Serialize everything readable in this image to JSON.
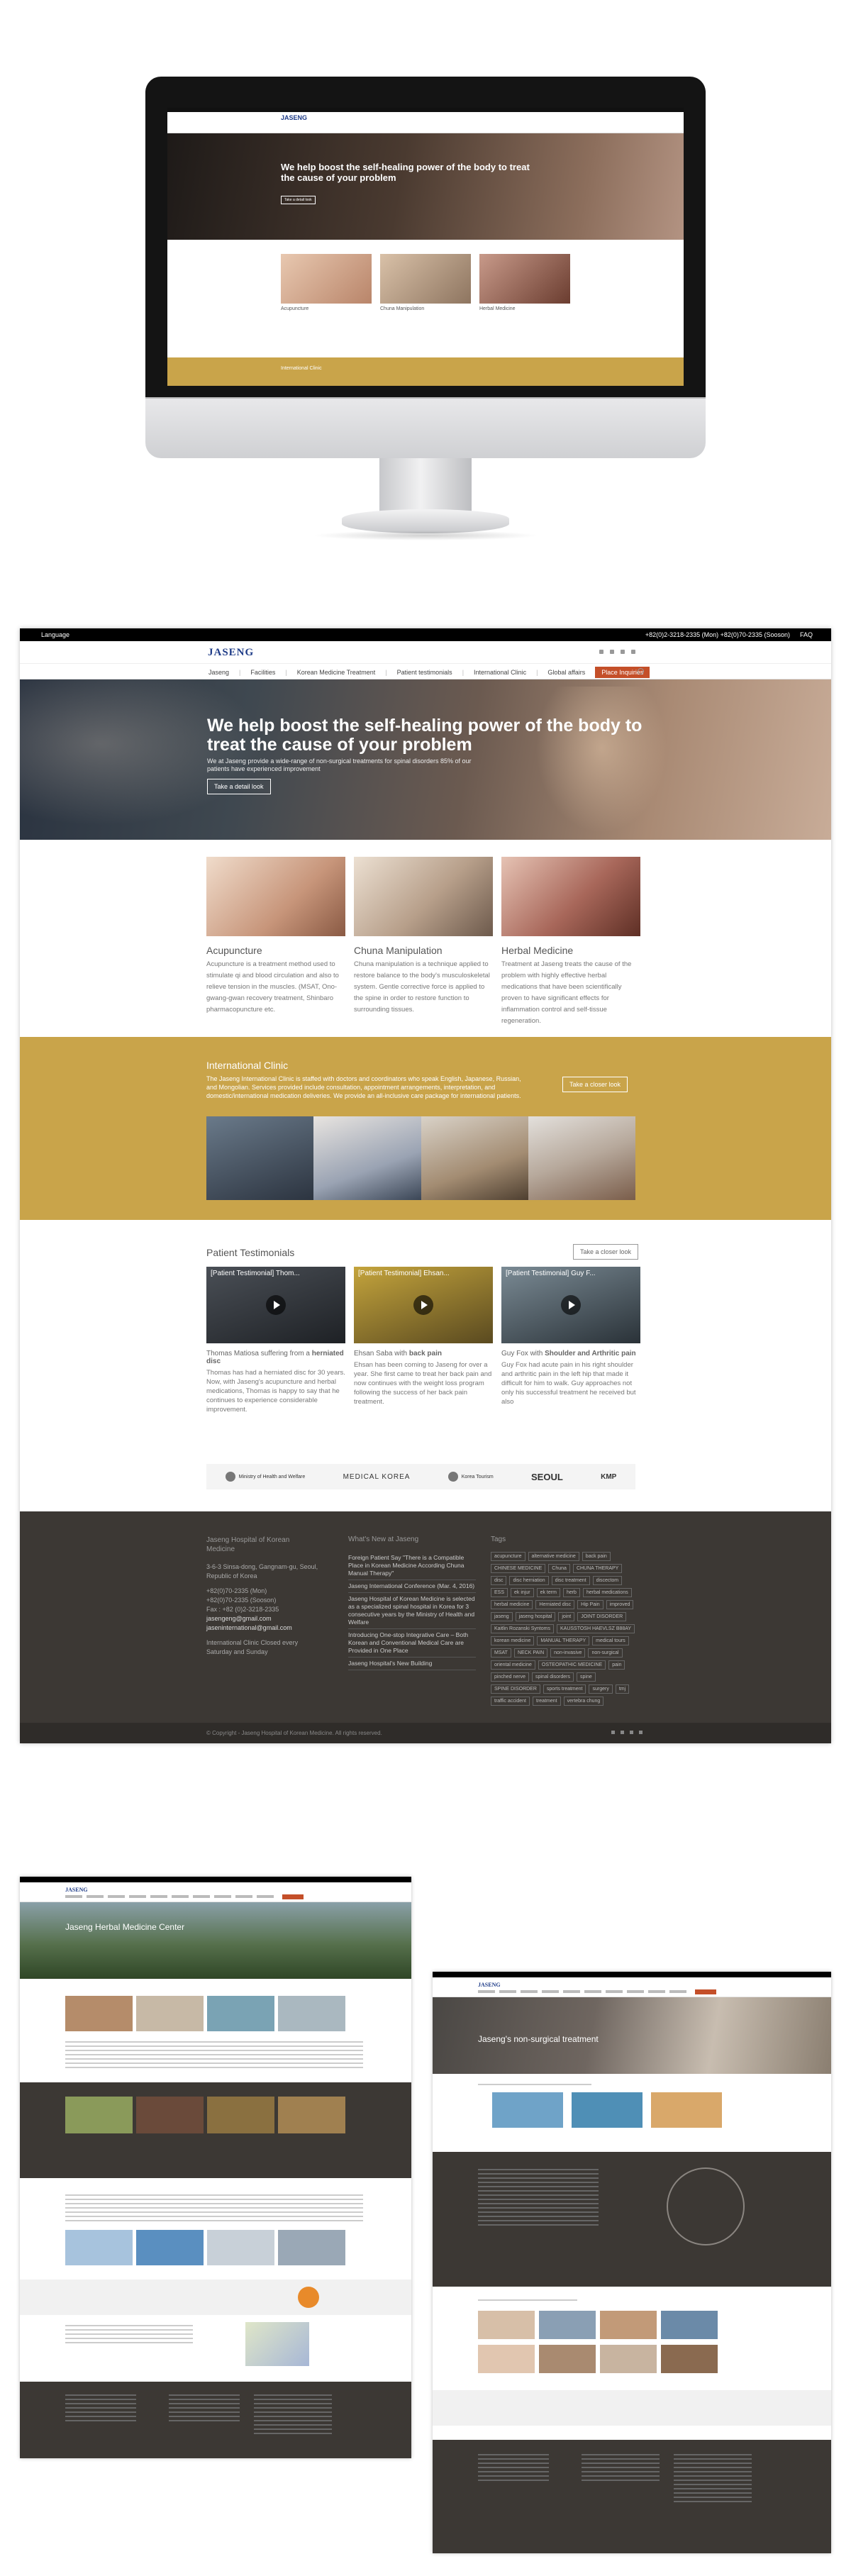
{
  "mockup": {
    "logo": "JASENG",
    "hero_title": "We help boost the self-healing power of the body to treat the cause of your problem",
    "hero_button": "Take a detail look",
    "cards": [
      "Acupuncture",
      "Chuna Manipulation",
      "Herbal Medicine"
    ],
    "band_title": "International Clinic"
  },
  "topbar": {
    "language": "Language",
    "phone": "+82(0)2-3218-2335 (Mon) +82(0)70-2335 (Sooson)",
    "faq": "FAQ"
  },
  "brand": {
    "logo": "JASENG"
  },
  "nav": {
    "items": [
      "Jaseng",
      "Facilities",
      "Korean Medicine Treatment",
      "Patient testimonials",
      "International Clinic",
      "Global affairs"
    ],
    "place_inquiries": "Place Inquiries"
  },
  "hero": {
    "title": "We help boost the self-healing power of the body to treat the cause of your problem",
    "subtitle": "We at Jaseng provide a wide-range of non-surgical treatments for spinal disorders 85% of our patients have experienced improvement",
    "button": "Take a detail look"
  },
  "treatments": [
    {
      "title": "Acupuncture",
      "text": "Acupuncture is a treatment method used to stimulate qi and blood circulation and also to relieve tension in the muscles. (MSAT, Ono-gwang-gwan recovery treatment, Shinbaro pharmacopuncture etc."
    },
    {
      "title": "Chuna Manipulation",
      "text": "Chuna manipulation is a technique applied to restore balance to the body's musculoskeletal system. Gentle corrective force is applied to the spine in order to restore function to surrounding tissues."
    },
    {
      "title": "Herbal Medicine",
      "text": "Treatment at Jaseng treats the cause of the problem with highly effective herbal medications that have been scientifically proven to have significant effects for inflammation control and self-tissue regeneration."
    }
  ],
  "intl": {
    "title": "International Clinic",
    "text": "The Jaseng International Clinic is staffed with doctors and coordinators who speak English, Japanese, Russian, and Mongolian. Services provided include consultation, appointment arrangements, interpretation, and domestic/international medication deliveries. We provide an all-inclusive care package for international patients.",
    "button": "Take a closer look"
  },
  "testimonials": {
    "title": "Patient Testimonials",
    "button": "Take a closer look",
    "videos": [
      {
        "video_title": "[Patient Testimonial] Thom...",
        "name": "Thomas Matiosa suffering from a",
        "bold": "herniated disc",
        "text": "Thomas has had a herniated disc for 30 years. Now, with Jaseng's acupuncture and herbal medications, Thomas is happy to say that he continues to experience considerable improvement."
      },
      {
        "video_title": "[Patient Testimonial] Ehsan...",
        "name": "Ehsan Saba with",
        "bold": "back pain",
        "text": "Ehsan has been coming to Jaseng for over a year. She first came to treat her back pain and now continues with the weight loss program following the success of her back pain treatment."
      },
      {
        "video_title": "[Patient Testimonial] Guy F...",
        "name": "Guy Fox with",
        "bold": "Shoulder and Arthritic pain",
        "text": "Guy Fox had acute pain in his right shoulder and arthritic pain in the left hip that made it difficult for him to walk. Guy approaches not only his successful treatment he received but also"
      }
    ]
  },
  "partners": [
    "Ministry of Health and Welfare",
    "MEDICAL KOREA",
    "Korea Tourism",
    "SEOUL",
    "KMP"
  ],
  "footer": {
    "col1_title": "Jaseng Hospital of Korean Medicine",
    "address": "3-6-3 Sinsa-dong, Gangnam-gu, Seoul, Republic of Korea",
    "tel1": "+82(0)70-2335 (Mon)",
    "tel2": "+82(0)70-2335 (Sooson)",
    "fax": "Fax : +82 (0)2-3218-2335",
    "email1": "jasengeng@gmail.com",
    "email2": "jaseninternational@gmail.com",
    "hours": "International Clinic Closed every Saturday and Sunday",
    "col2_title": "What's New at Jaseng",
    "news": [
      "Foreign Patient Say \"There is a Compatible Place in Korean Medicine According Chuna Manual Therapy\"",
      "Jaseng International Conference (Mar. 4, 2016)",
      "Jaseng Hospital of Korean Medicine is selected as a specialized spinal hospital in Korea for 3 consecutive years by the Ministry of Health and Welfare",
      "Introducing One-stop Integrative Care – Both Korean and Conventional Medical Care are Provided in One Place",
      "Jaseng Hospital's New Building"
    ],
    "col3_title": "Tags",
    "tags": [
      "acupuncture",
      "alternative medicine",
      "back pain",
      "CHINESE MEDICINE",
      "Chuna",
      "CHUNA THERAPY",
      "disc",
      "disc herniation",
      "disc treatment",
      "discectom",
      "ESS",
      "ek injur",
      "ek term",
      "herb",
      "herbal medications",
      "herbal medicine",
      "Herniated disc",
      "Hip Pain",
      "improved",
      "jaseng",
      "jaseng hospital",
      "joint",
      "JOINT DISORDER",
      "Kaitlin Rozanski Syntoms",
      "KAUSSTOSH HAEVLSZ B88AY",
      "korean medicine",
      "MANUAL THERAPY",
      "medical tours",
      "MSAT",
      "NECK PAIN",
      "non-invasive",
      "non-surgical",
      "oriental medicine",
      "OSTEOPATHIC MEDICINE",
      "pain",
      "pinched nerve",
      "spinal disorders",
      "spine",
      "SPINE DISORDER",
      "sports treatment",
      "surgery",
      "tmj",
      "traffic accident",
      "treatment",
      "vertebra chung"
    ],
    "copyright": "© Copyright - Jaseng Hospital of Korean Medicine. All rights reserved."
  },
  "screens": {
    "herbal_title": "Jaseng Herbal Medicine Center",
    "non_surgical_title": "Jaseng's non-surgical treatment"
  }
}
